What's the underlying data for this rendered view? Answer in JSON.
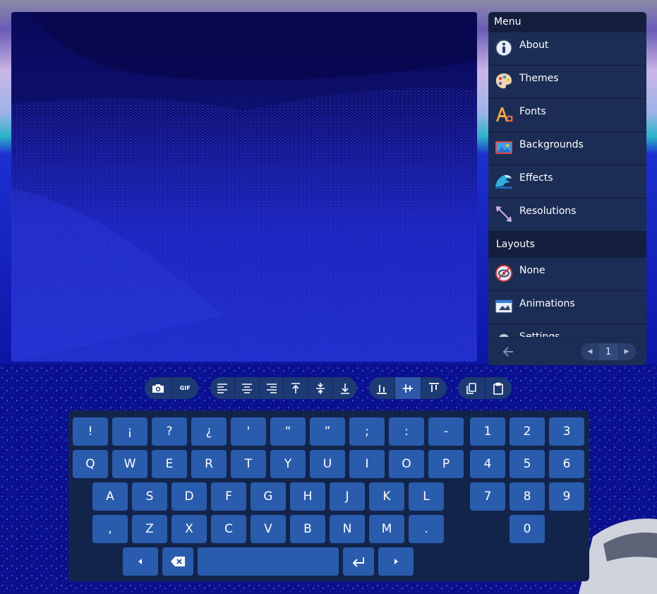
{
  "menu": {
    "header": "Menu",
    "items": [
      {
        "label": "About",
        "icon": "info-icon"
      },
      {
        "label": "Themes",
        "icon": "palette-icon"
      },
      {
        "label": "Fonts",
        "icon": "font-icon"
      },
      {
        "label": "Backgrounds",
        "icon": "picture-icon"
      },
      {
        "label": "Effects",
        "icon": "wave-icon"
      },
      {
        "label": "Resolutions",
        "icon": "resize-icon"
      }
    ],
    "section": "Layouts",
    "layout_items": [
      {
        "label": "None",
        "icon": "hidden-icon"
      },
      {
        "label": "Animations",
        "icon": "animation-icon"
      },
      {
        "label": "Settings",
        "icon": "gear-icon"
      }
    ],
    "page": "1"
  },
  "toolbar": {
    "gif_label": "GIF"
  },
  "keyboard": {
    "row1": [
      "!",
      "¡",
      "?",
      "¿",
      "'",
      "“",
      "”",
      ";",
      ":",
      "-"
    ],
    "row2": [
      "Q",
      "W",
      "E",
      "R",
      "T",
      "Y",
      "U",
      "I",
      "O",
      "P"
    ],
    "row3": [
      "A",
      "S",
      "D",
      "F",
      "G",
      "H",
      "J",
      "K",
      "L"
    ],
    "row4": [
      ",",
      "Z",
      "X",
      "C",
      "V",
      "B",
      "N",
      "M",
      "."
    ],
    "numpad": [
      "1",
      "2",
      "3",
      "4",
      "5",
      "6",
      "7",
      "8",
      "9",
      "0"
    ],
    "bottom_icons": [
      "cursor-left-icon",
      "backspace-icon",
      "space-key",
      "enter-icon",
      "cursor-right-icon"
    ]
  },
  "colors": {
    "panel": "#1b2d55",
    "panel_header": "#131f3c",
    "key": "#2a5cae",
    "keyboard_bg": "#13244b",
    "toolbar": "#1c3a74"
  }
}
